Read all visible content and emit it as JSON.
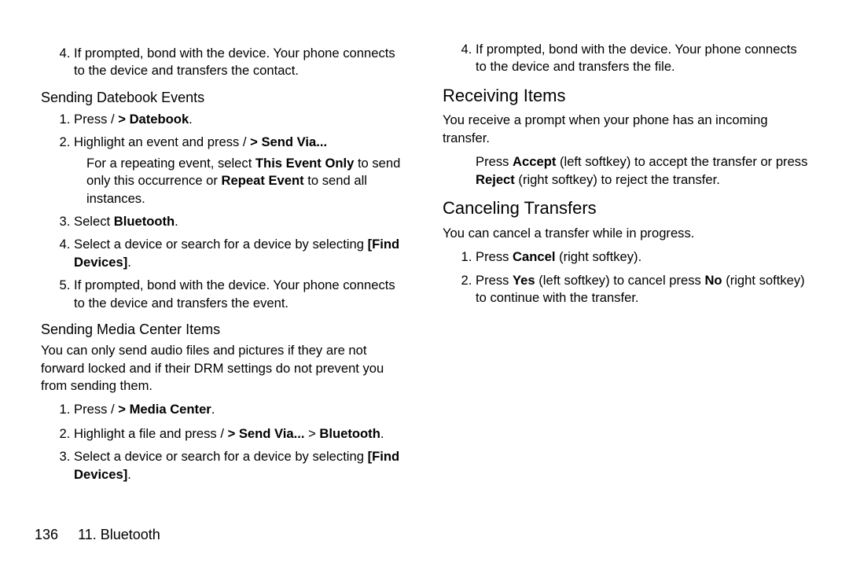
{
  "col1": {
    "step4": {
      "num": "4.",
      "text": "If prompted, bond with the device. Your phone connects to the device and transfers the contact."
    },
    "h3a": "Sending Datebook Events",
    "db": {
      "s1_pre": "Press /",
      "s1_bold": "> Datebook",
      "s1_post": ".",
      "s2_pre": "Highlight an event and press /",
      "s2_bold": "> Send Via...",
      "s2_sub_a": "For a repeating event, select ",
      "s2_sub_b": "This Event Only",
      "s2_sub_c": " to send only this occurrence or ",
      "s2_sub_d": "Repeat Event",
      "s2_sub_e": " to send all instances.",
      "s3_pre": "Select ",
      "s3_bold": "Bluetooth",
      "s3_post": ".",
      "s4_pre": "Select a device or search for a device by selecting ",
      "s4_bold": "[Find Devices]",
      "s4_post": ".",
      "s5": "If prompted, bond with the device. Your phone connects to the device and transfers the event."
    },
    "h3b": "Sending Media Center Items",
    "mc_intro": "You can only send audio files and pictures if they are not forward locked and if their DRM settings do not prevent you from sending them.",
    "mc_s1_pre": "Press /",
    "mc_s1_bold": "> Media Center",
    "mc_s1_post": "."
  },
  "col2": {
    "s2_pre": "Highlight a file and press /",
    "s2_bold1": "> Send Via...",
    "s2_mid": " > ",
    "s2_bold2": "Bluetooth",
    "s2_post": ".",
    "s3_pre": "Select a device or search for a device by selecting ",
    "s3_bold": "[Find Devices]",
    "s3_post": ".",
    "s4": "If prompted, bond with the device. Your phone connects to the device and transfers the file.",
    "h2a": "Receiving Items",
    "rcv_p": "You receive a prompt when your phone has an incoming transfer.",
    "rcv_sub_a": "Press ",
    "rcv_sub_b": "Accept",
    "rcv_sub_c": " (left softkey) to accept the transfer or press ",
    "rcv_sub_d": "Reject",
    "rcv_sub_e": " (right softkey) to reject the transfer.",
    "h2b": "Canceling Transfers",
    "can_p": "You can cancel a transfer while in progress.",
    "can_s1_a": "Press ",
    "can_s1_b": "Cancel",
    "can_s1_c": " (right softkey).",
    "can_s2_a": "Press ",
    "can_s2_b": "Yes",
    "can_s2_c": " (left softkey) to cancel press ",
    "can_s2_d": "No",
    "can_s2_e": " (right softkey) to continue with the transfer."
  },
  "footer": {
    "page": "136",
    "chapter": "11. Bluetooth"
  }
}
